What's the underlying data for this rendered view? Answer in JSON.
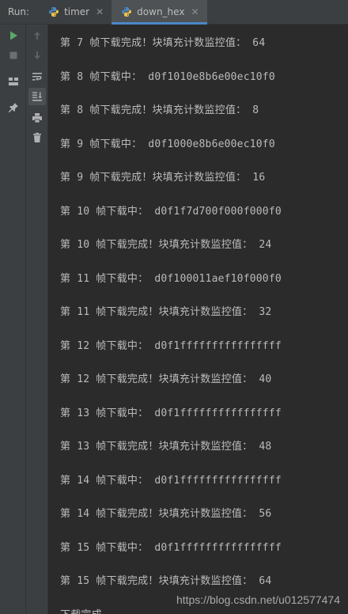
{
  "header": {
    "run_label": "Run:",
    "tabs": [
      {
        "label": "timer",
        "active": false
      },
      {
        "label": "down_hex",
        "active": true
      }
    ],
    "close_glyph": "✕"
  },
  "console": {
    "lines": [
      "第 7 帧下载完成！块填充计数监控值： 64",
      "第 8 帧下载中： d0f1010e8b6e00ec10f0",
      "第 8 帧下载完成！块填充计数监控值： 8",
      "第 9 帧下载中： d0f1000e8b6e00ec10f0",
      "第 9 帧下载完成！块填充计数监控值： 16",
      "第 10 帧下载中： d0f1f7d700f000f000f0",
      "第 10 帧下载完成！块填充计数监控值： 24",
      "第 11 帧下载中： d0f100011aef10f000f0",
      "第 11 帧下载完成！块填充计数监控值： 32",
      "第 12 帧下载中： d0f1ffffffffffffffff",
      "第 12 帧下载完成！块填充计数监控值： 40",
      "第 13 帧下载中： d0f1ffffffffffffffff",
      "第 13 帧下载完成！块填充计数监控值： 48",
      "第 14 帧下载中： d0f1ffffffffffffffff",
      "第 14 帧下载完成！块填充计数监控值： 56",
      "第 15 帧下载中： d0f1ffffffffffffffff",
      "第 15 帧下载完成！块填充计数监控值： 64",
      "下载完成"
    ]
  },
  "watermark": "https://blog.csdn.net/u012577474",
  "colors": {
    "run_green": "#59a869",
    "stop_gray": "#6e6e6e",
    "python_blue": "#4a88c7",
    "python_yellow": "#f0c44c",
    "text": "#bbbbbb"
  },
  "icons": {
    "left": [
      "run-icon",
      "stop-icon",
      "layout-icon",
      "pin-icon"
    ],
    "mid": [
      "up-arrow-icon",
      "down-arrow-icon",
      "soft-wrap-icon",
      "scroll-to-end-icon",
      "print-icon",
      "trash-icon"
    ]
  }
}
